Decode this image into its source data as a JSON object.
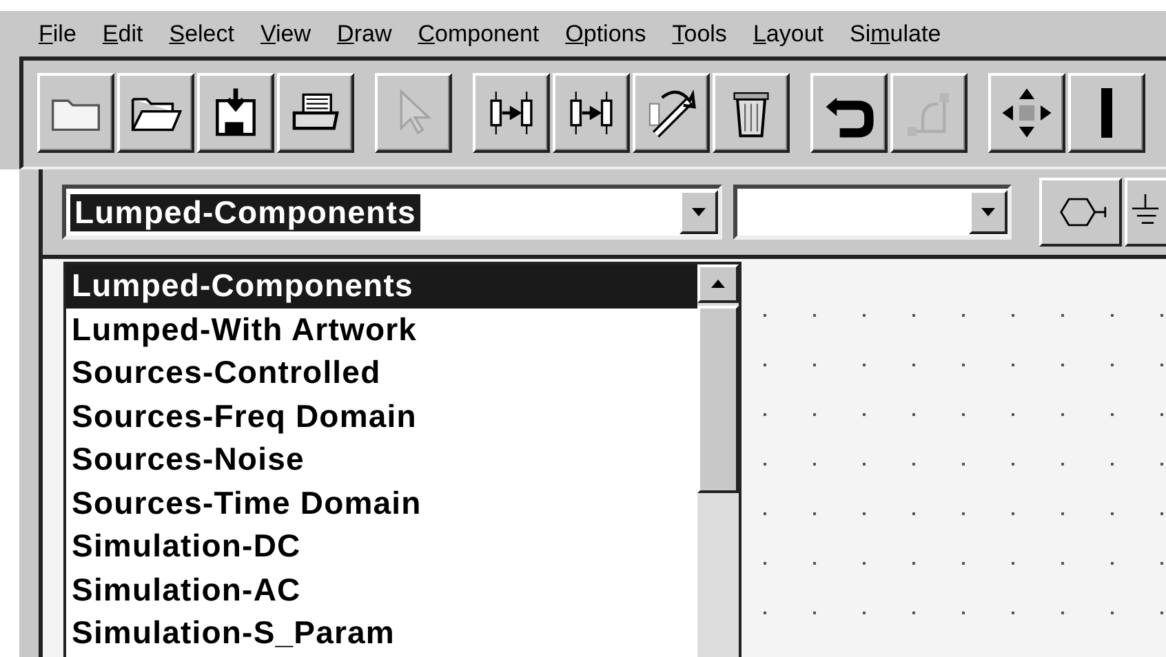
{
  "menu": [
    {
      "key": "F",
      "after": "ile"
    },
    {
      "key": "E",
      "after": "dit"
    },
    {
      "key": "S",
      "after": "elect"
    },
    {
      "key": "V",
      "after": "iew"
    },
    {
      "key": "D",
      "after": "raw"
    },
    {
      "key": "C",
      "after": "omponent"
    },
    {
      "key": "O",
      "after": "ptions"
    },
    {
      "key": "T",
      "after": "ools"
    },
    {
      "key": "L",
      "after": "ayout"
    },
    {
      "before": "Si",
      "key": "m",
      "after": "ulate"
    }
  ],
  "toolbar": [
    [
      {
        "kind": "folder",
        "disabled": false
      },
      {
        "kind": "open",
        "disabled": false
      },
      {
        "kind": "save",
        "disabled": false
      },
      {
        "kind": "print",
        "disabled": false
      }
    ],
    [
      {
        "kind": "pointer",
        "disabled": true
      }
    ],
    [
      {
        "kind": "insert-left",
        "disabled": false
      },
      {
        "kind": "insert-right",
        "disabled": false
      },
      {
        "kind": "swap",
        "disabled": false
      },
      {
        "kind": "trash",
        "disabled": false
      }
    ],
    [
      {
        "kind": "undo",
        "disabled": false
      },
      {
        "kind": "route",
        "disabled": true
      }
    ],
    [
      {
        "kind": "move",
        "disabled": false
      },
      {
        "kind": "edge",
        "disabled": false
      }
    ]
  ],
  "palette_select": {
    "value": "Lumped-Components",
    "open": true,
    "items": [
      {
        "label": "Lumped-Components",
        "selected": true
      },
      {
        "label": "Lumped-With Artwork",
        "selected": false
      },
      {
        "label": "Sources-Controlled",
        "selected": false
      },
      {
        "label": "Sources-Freq Domain",
        "selected": false
      },
      {
        "label": "Sources-Noise",
        "selected": false
      },
      {
        "label": "Sources-Time Domain",
        "selected": false
      },
      {
        "label": "Simulation-DC",
        "selected": false
      },
      {
        "label": "Simulation-AC",
        "selected": false
      },
      {
        "label": "Simulation-S_Param",
        "selected": false
      }
    ]
  },
  "component_buttons": [
    {
      "kind": "port"
    },
    {
      "kind": "ground"
    }
  ]
}
